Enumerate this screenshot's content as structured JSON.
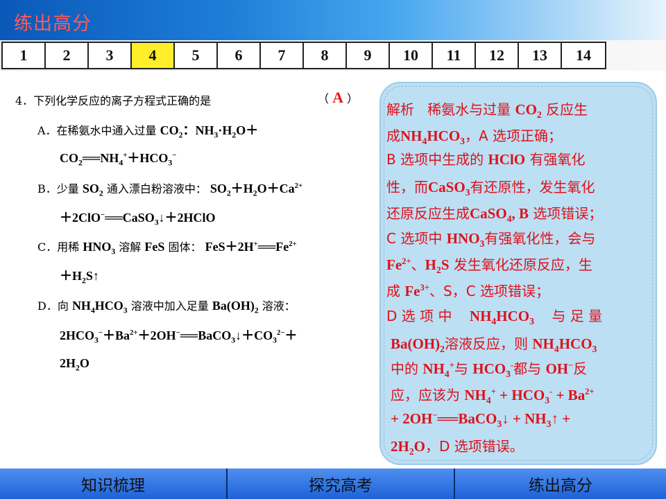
{
  "header": {
    "title": "练出高分"
  },
  "tabs": {
    "items": [
      "1",
      "2",
      "3",
      "4",
      "5",
      "6",
      "7",
      "8",
      "9",
      "10",
      "11",
      "12",
      "13",
      "14"
    ],
    "active": "4"
  },
  "question": {
    "stem": "4．下列化学反应的离子方程式正确的是",
    "answer_open": "（",
    "answer": "A",
    "answer_close": "）",
    "option_a_prefix": "A．在稀氨水中通入过量",
    "option_b_prefix": "B．少量",
    "option_b_mid": "通入漂白粉溶液中：",
    "option_c_prefix": "C．用稀",
    "option_c_mid": "溶解",
    "option_c_mid2": "固体：",
    "option_d_prefix": "D．向",
    "option_d_mid": "溶液中加入足量",
    "option_d_mid2": "溶液："
  },
  "analysis": {
    "label": "解析",
    "l1": "稀氨水与过量",
    "l1b": "反应生",
    "l2a": "成",
    "l2b": "，A 选项正确；",
    "l3a": "B 选项中生成的",
    "l3b": "有强氧化",
    "l4a": "性，而",
    "l4b": "有还原性，发生氧化",
    "l5a": "还原反应生成",
    "l5b": "选项错误；",
    "l6a": "C 选项中",
    "l6b": "有强氧化性，会与",
    "l7a": "、",
    "l7b": "发生氧化还原反应，生",
    "l8a": "成",
    "l8b": "、S，C 选项错误；",
    "l9a": "D 选 项 中",
    "l9b": "与 足 量",
    "l10a": "溶液反应，则",
    "l11a": "中的",
    "l11b": "与",
    "l11c": "都与",
    "l11d": "反",
    "l12a": "应，应该为",
    "l14a": "，D 选项错误。"
  },
  "footer": {
    "items": [
      "知识梳理",
      "探究高考",
      "练出高分"
    ]
  },
  "colors": {
    "accent_red": "#e31b1b",
    "tab_active": "#ffee2a",
    "panel_bg": "#bcdff3",
    "footer_bg": "#2f73e0"
  }
}
